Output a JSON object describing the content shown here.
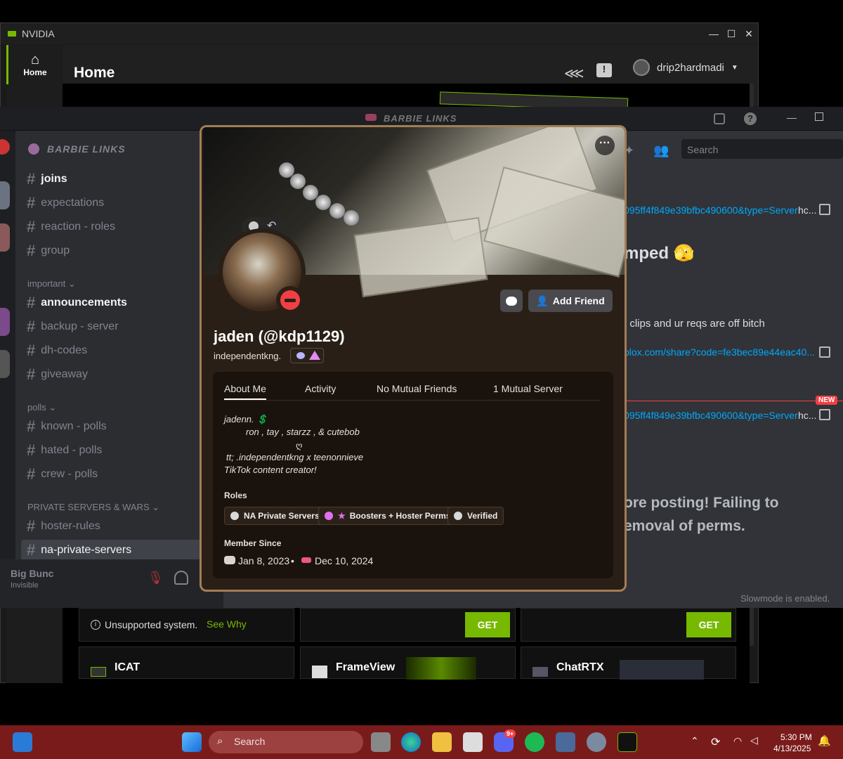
{
  "nvidia": {
    "title": "NVIDIA",
    "nav_home": "Home",
    "header_title": "Home",
    "username": "drip2hardmadi",
    "unsupported": "Unsupported system.",
    "see_why": "See Why",
    "get_label": "GET",
    "cards": [
      "ICAT",
      "FrameView",
      "ChatRTX"
    ],
    "brand_color": "#76b900"
  },
  "discord": {
    "window_title": "BARBIE LINKS",
    "server_name": "BARBIE LINKS",
    "channels_top": [
      "joins",
      "expectations",
      "reaction - roles",
      "group"
    ],
    "category_important": "important",
    "channels_important": [
      "announcements",
      "backup - server",
      "dh-codes",
      "giveaway"
    ],
    "category_polls": "polls",
    "channels_polls": [
      "known - polls",
      "hated - polls",
      "crew - polls"
    ],
    "category_private": "PRIVATE SERVERS & WARS",
    "channels_private": [
      "hoster-rules",
      "na-private-servers"
    ],
    "user_name": "Big Bunc",
    "user_status": "Invisible",
    "search_placeholder": "Search",
    "messages": [
      "095ff4f849e39bfbc490600&type=Server",
      "hc...",
      "mped 🫣",
      "t clips and ur reqs are off bitch",
      "blox.com/share?code=fe3bec89e44eac40...",
      "NEW",
      "095ff4f849e39bfbc490600&type=Server",
      "hc...",
      "ore posting! Failing to",
      "emoval of perms.",
      "Slowmode is enabled."
    ]
  },
  "profile": {
    "display_name": "jaden (@kdp1129)",
    "tag": "independentkng.",
    "add_friend": "Add Friend",
    "tabs": [
      "About Me",
      "Activity",
      "No Mutual Friends",
      "1 Mutual Server"
    ],
    "about_lines": [
      "jadenn. 💲",
      "ron , tay , starzz , & cutebob",
      "ღ",
      "tt; .independentkng x teenonnieve",
      "TikTok content creator!"
    ],
    "roles_label": "Roles",
    "roles": [
      {
        "name": "NA Private Servers",
        "color": "#d9d9d9"
      },
      {
        "name": "Boosters + Hoster Perms",
        "color": "#e070f0"
      },
      {
        "name": "Verified",
        "color": "#d9d9d9"
      }
    ],
    "member_since_label": "Member Since",
    "discord_since": "Jan 8, 2023",
    "server_since": "Dec 10, 2024",
    "separator": "•"
  },
  "taskbar": {
    "search": "Search",
    "time": "5:30 PM",
    "date": "4/13/2025",
    "discord_badge": "9+"
  }
}
